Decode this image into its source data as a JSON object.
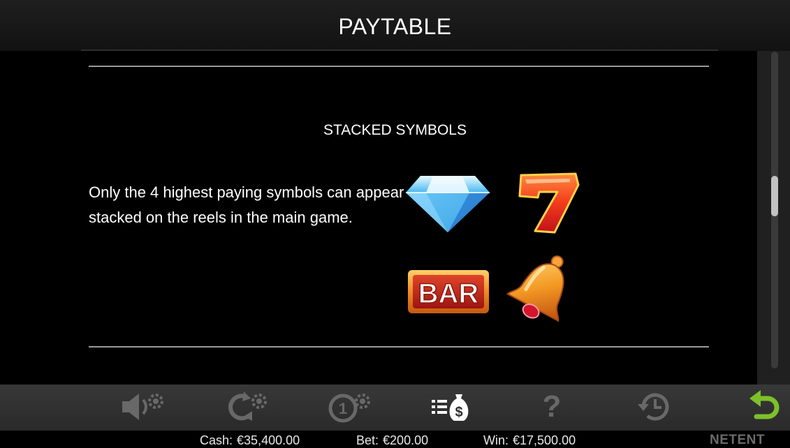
{
  "header": {
    "title": "PAYTABLE"
  },
  "section": {
    "title": "STACKED SYMBOLS",
    "description": "Only the 4 highest paying symbols can appear stacked on the reels in the main game."
  },
  "symbols": [
    {
      "name": "diamond",
      "icon": "diamond-symbol"
    },
    {
      "name": "seven",
      "icon": "seven-symbol",
      "glyph": "7"
    },
    {
      "name": "bar",
      "icon": "bar-symbol",
      "label": "BAR"
    },
    {
      "name": "bell",
      "icon": "bell-symbol"
    }
  ],
  "toolbar": {
    "items": [
      {
        "name": "sound-settings",
        "icon": "speaker-gear-icon"
      },
      {
        "name": "autoplay-settings",
        "icon": "autoplay-gear-icon"
      },
      {
        "name": "bet-settings",
        "icon": "coin-gear-icon"
      },
      {
        "name": "paytable",
        "icon": "paytable-money-icon",
        "active": true
      },
      {
        "name": "help",
        "icon": "question-icon",
        "glyph": "?"
      },
      {
        "name": "history",
        "icon": "history-clock-icon"
      },
      {
        "name": "back",
        "icon": "return-arrow-icon"
      }
    ]
  },
  "status": {
    "cash_label": "Cash:",
    "cash_value": "€35,400.00",
    "bet_label": "Bet:",
    "bet_value": "€200.00",
    "win_label": "Win:",
    "win_value": "€17,500.00",
    "brand": "NETENT"
  },
  "colors": {
    "background": "#000000",
    "toolbar": "#303030",
    "icon_inactive": "#686868",
    "icon_active": "#ffffff",
    "back_green": "#7cc02a"
  }
}
